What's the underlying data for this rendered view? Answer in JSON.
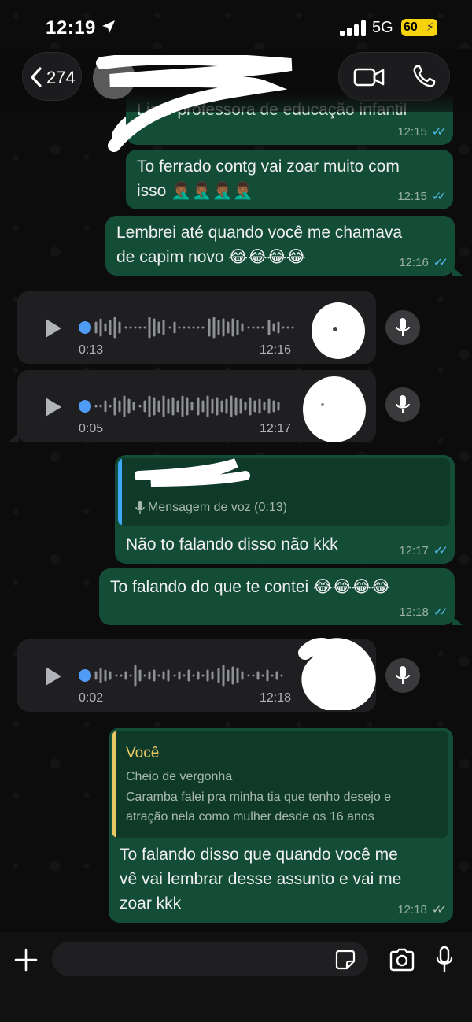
{
  "status_bar": {
    "time": "12:19",
    "network": "5G",
    "battery": "60"
  },
  "header": {
    "back_count": "274"
  },
  "messages": {
    "m1": {
      "text": "Lia e professora de educação infantil",
      "time": "12:15"
    },
    "m2": {
      "line1": "To ferrado contg vai zoar muito com",
      "line2": "isso 🤦🏾‍♂️🤦🏾‍♂️🤦🏾‍♂️🤦🏾‍♂️",
      "time": "12:15"
    },
    "m3": {
      "line1": "Lembrei até quando você me chamava",
      "line2": "de capim novo 😂😂😂😂",
      "time": "12:16"
    },
    "voice1": {
      "duration": "0:13",
      "time": "12:16"
    },
    "voice2": {
      "duration": "0:05",
      "time": "12:17"
    },
    "m4": {
      "quote_text": "Mensagem de voz (0:13)",
      "text": "Não to falando disso não  kkk",
      "time": "12:17"
    },
    "m5": {
      "text": "To falando do que te contei 😂😂😂😂",
      "time": "12:18"
    },
    "voice3": {
      "duration": "0:02",
      "time": "12:18"
    },
    "m6": {
      "quote_author": "Você",
      "quote_line1": "Cheio de vergonha",
      "quote_line2": "Caramba falei pra minha tia que tenho desejo e",
      "quote_line3": "atração nela como mulher desde os 16 anos",
      "line1": "To falando disso que quando você me",
      "line2": "vê vai lembrar desse assunto e vai me",
      "line3": "zoar kkk",
      "time": "12:18"
    }
  },
  "colors": {
    "outgoing_bubble": "#144d37",
    "incoming_bubble": "#1f1f21",
    "read_ticks": "#53bdeb",
    "quote_author": "#e8c862",
    "voice_dot": "#4f9cf7"
  },
  "icons": [
    "location-arrow-icon",
    "signal-icon",
    "chevron-left-icon",
    "video-call-icon",
    "phone-icon",
    "play-icon",
    "mic-icon",
    "plus-icon",
    "sticker-icon",
    "camera-icon"
  ]
}
